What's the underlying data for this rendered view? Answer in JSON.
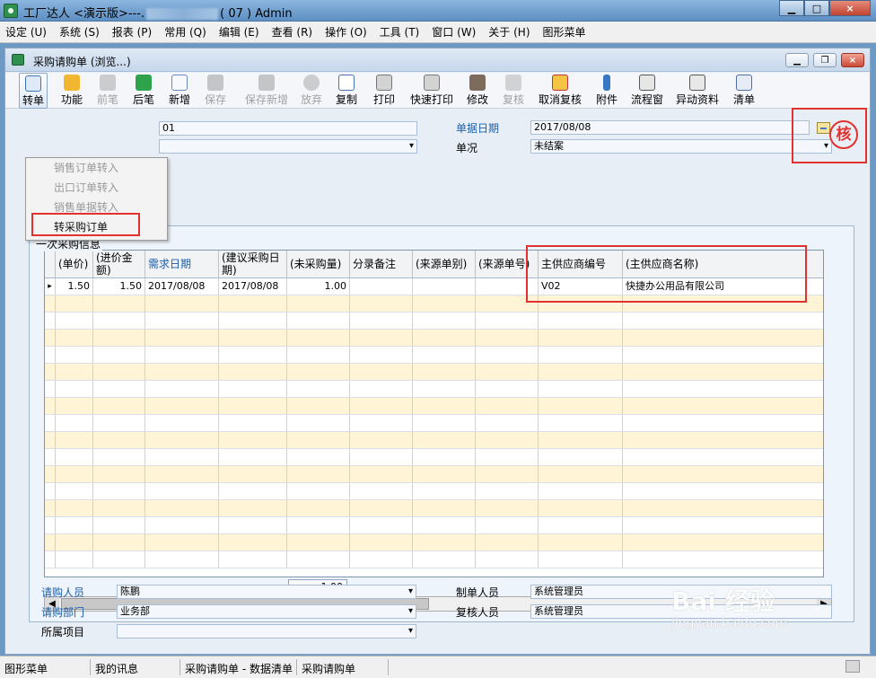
{
  "window": {
    "title": "工厂达人 <演示版>---.",
    "title_suffix": "( 07 ) Admin"
  },
  "menu": [
    "设定 (U)",
    "系统 (S)",
    "报表 (P)",
    "常用 (Q)",
    "编辑 (E)",
    "查看 (R)",
    "操作 (O)",
    "工具 (T)",
    "窗口 (W)",
    "关于 (H)",
    "图形菜单"
  ],
  "child": {
    "title": "采购请购单 (浏览...)"
  },
  "toolbar": [
    "转单",
    "功能",
    "前笔",
    "后笔",
    "新增",
    "保存",
    "保存新增",
    "放弃",
    "复制",
    "打印",
    "快速打印",
    "修改",
    "复核",
    "取消复核",
    "附件",
    "流程窗",
    "异动资料",
    "清单"
  ],
  "dropdown": [
    "销售订单转入",
    "出口订单转入",
    "销售单据转入",
    "转采购订单"
  ],
  "header": {
    "bill_no_partial": "01",
    "bill_date_label": "单据日期",
    "bill_date": "2017/08/08",
    "status_label": "单况",
    "status": "未结案",
    "stamp": "核"
  },
  "grid": {
    "group_title": "一次采购信息",
    "columns": [
      "(单价)",
      "(进价金额)",
      "需求日期",
      "(建议采购日期)",
      "(未采购量)",
      "分录备注",
      "(来源单别)",
      "(来源单号)",
      "主供应商编号",
      "(主供应商名称)"
    ],
    "rows": [
      {
        "price": "1.50",
        "amount": "1.50",
        "need_date": "2017/08/08",
        "suggest_date": "2017/08/08",
        "unpurchased": "1.00",
        "remark": "",
        "source_type": "",
        "source_no": "",
        "supplier_no": "V02",
        "supplier_name": "快捷办公用品有限公司"
      }
    ],
    "total": "1.00"
  },
  "footer": {
    "requester_label": "请购人员",
    "requester": "陈鹏",
    "department_label": "请购部门",
    "department": "业务部",
    "project_label": "所属项目",
    "project": "",
    "maker_label": "制单人员",
    "maker": "系统管理员",
    "reviewer_label": "复核人员",
    "reviewer": "系统管理员"
  },
  "status_bar": [
    "图形菜单",
    "我的讯息",
    "采购请购单 - 数据清单",
    "采购请购单"
  ],
  "watermark": {
    "text": "Bai 经验",
    "url": "jingyan.baidu.com"
  }
}
